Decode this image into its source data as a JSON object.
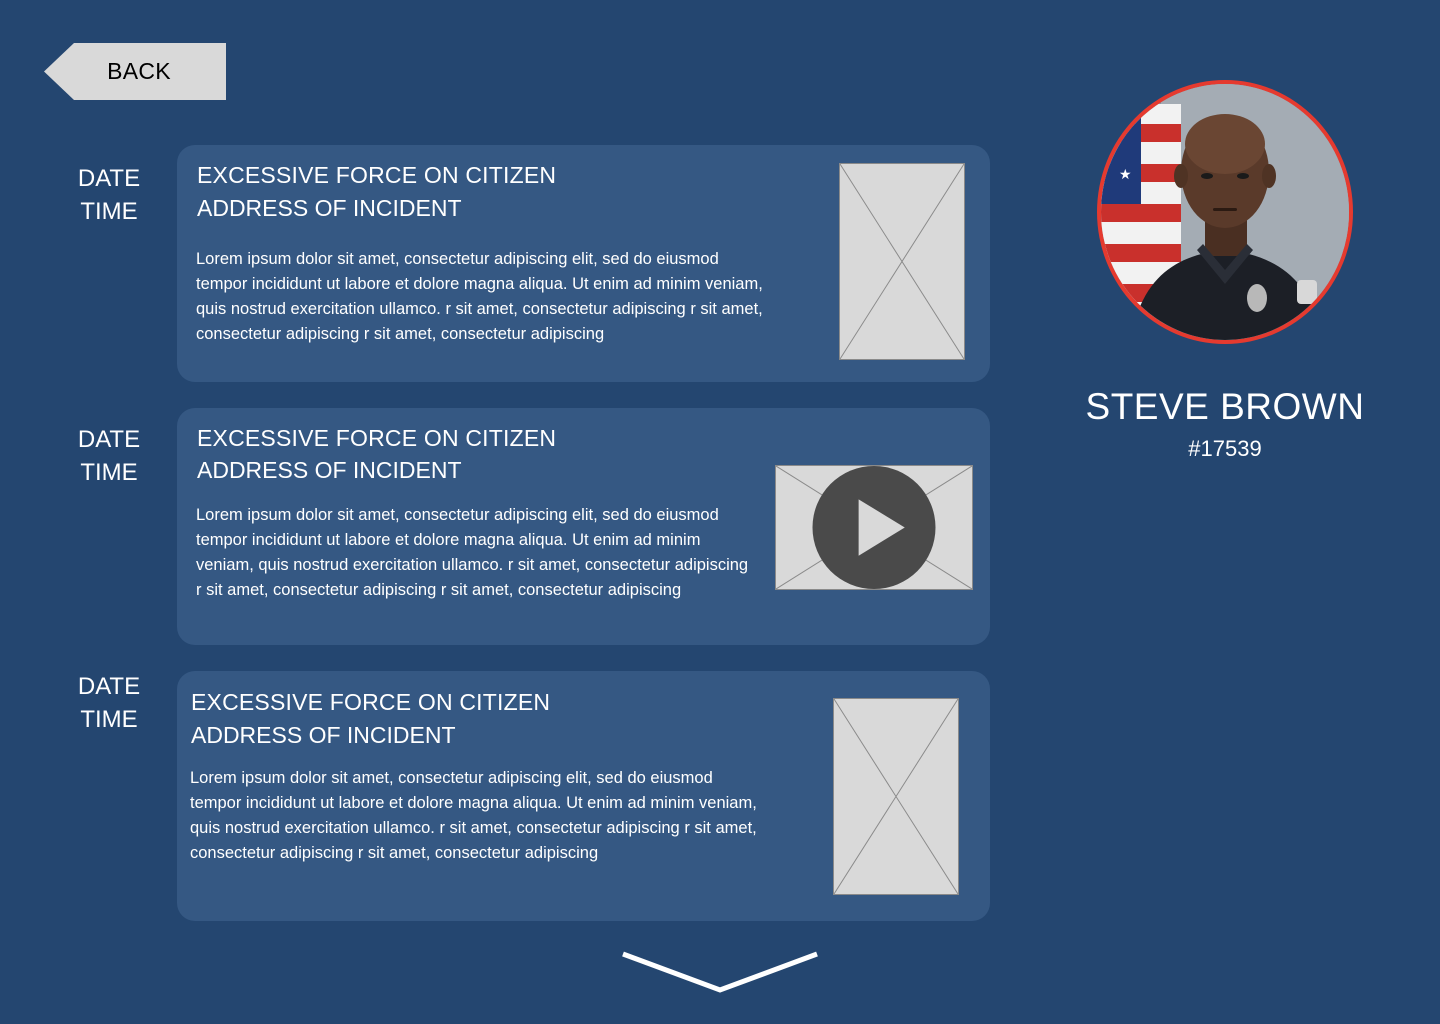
{
  "nav": {
    "back_label": "BACK"
  },
  "incidents": [
    {
      "date_label": "DATE",
      "time_label": "TIME",
      "title": "EXCESSIVE FORCE ON CITIZEN",
      "address": "ADDRESS OF INCIDENT",
      "description": "Lorem ipsum dolor sit amet, consectetur adipiscing elit, sed do eiusmod tempor incididunt ut labore et dolore magna aliqua. Ut enim ad minim veniam, quis nostrud exercitation ullamco. r sit amet, consectetur adipiscing r sit amet, consectetur adipiscing r sit amet, consectetur adipiscing",
      "media": "image-placeholder"
    },
    {
      "date_label": "DATE",
      "time_label": "TIME",
      "title": "EXCESSIVE FORCE ON CITIZEN",
      "address": "ADDRESS OF INCIDENT",
      "description": "Lorem ipsum dolor sit amet, consectetur adipiscing elit, sed do eiusmod tempor incididunt ut labore et dolore magna aliqua. Ut enim ad minim veniam, quis nostrud exercitation ullamco. r sit amet, consectetur adipiscing r sit amet, consectetur adipiscing r sit amet, consectetur adipiscing",
      "media": "video-placeholder"
    },
    {
      "date_label": "DATE",
      "time_label": "TIME",
      "title": "EXCESSIVE FORCE ON CITIZEN",
      "address": "ADDRESS OF INCIDENT",
      "description": "Lorem ipsum dolor sit amet, consectetur adipiscing elit, sed do eiusmod tempor incididunt ut labore et dolore magna aliqua. Ut enim ad minim veniam, quis nostrud exercitation ullamco. r sit amet, consectetur adipiscing r sit amet, consectetur adipiscing r sit amet, consectetur adipiscing",
      "media": "image-placeholder"
    }
  ],
  "officer": {
    "name": "STEVE BROWN",
    "badge": "#17539",
    "photo": "officer-portrait"
  },
  "icons": {
    "play": "play-icon",
    "scroll": "chevron-down-icon"
  },
  "colors": {
    "background": "#244670",
    "card": "#355883",
    "photo_ring": "#e53a2f",
    "placeholder": "#d9d9d9",
    "text": "#ffffff"
  }
}
